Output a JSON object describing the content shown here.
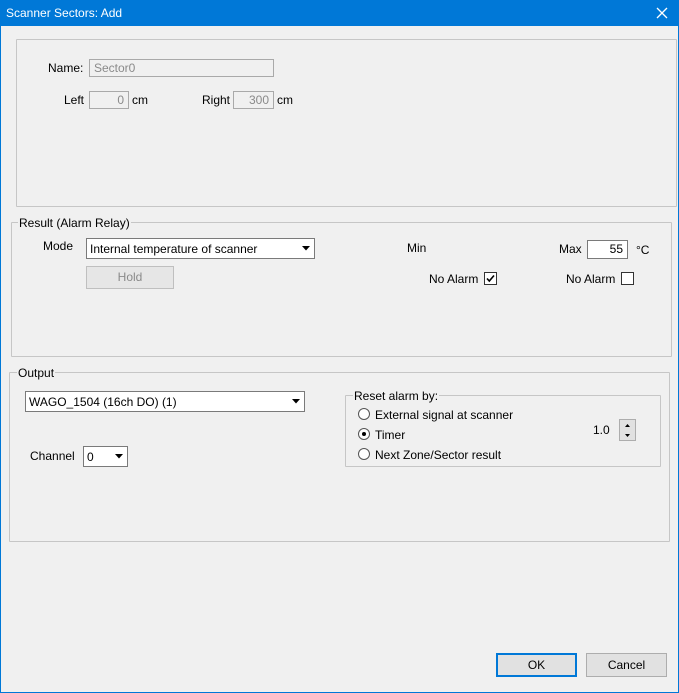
{
  "window": {
    "title": "Scanner Sectors: Add",
    "accent_color": "#0078d7",
    "close_icon": "close-icon"
  },
  "sector": {
    "name_label": "Name:",
    "name_value": "Sector0",
    "left_label": "Left",
    "left_value": "0",
    "left_unit": "cm",
    "right_label": "Right",
    "right_value": "300",
    "right_unit": "cm"
  },
  "result": {
    "legend": "Result (Alarm Relay)",
    "mode_label": "Mode",
    "mode_value": "Internal temperature of scanner",
    "hold_label": "Hold",
    "min_label": "Min",
    "max_label": "Max",
    "max_value": "55",
    "max_unit": "°C",
    "min_no_alarm_label": "No Alarm",
    "min_no_alarm_checked": true,
    "max_no_alarm_label": "No Alarm",
    "max_no_alarm_checked": false
  },
  "output": {
    "legend": "Output",
    "device_value": "WAGO_1504 (16ch DO) (1)",
    "channel_label": "Channel",
    "channel_value": "0",
    "reset": {
      "legend": "Reset alarm by:",
      "options": [
        {
          "label": "External signal at scanner",
          "selected": false
        },
        {
          "label": "Timer",
          "selected": true
        },
        {
          "label": "Next Zone/Sector result",
          "selected": false
        }
      ],
      "timer_value": "1.0"
    }
  },
  "buttons": {
    "ok": "OK",
    "cancel": "Cancel"
  }
}
